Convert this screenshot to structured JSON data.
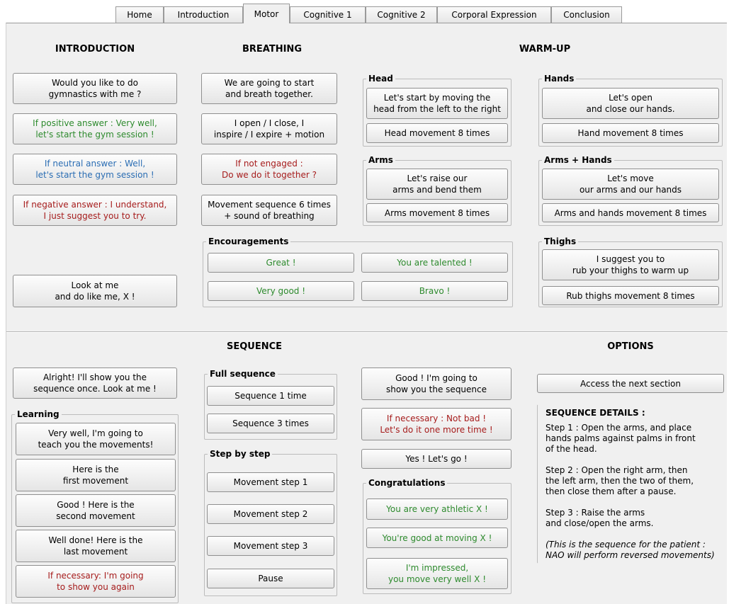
{
  "tabs": [
    {
      "label": "Home"
    },
    {
      "label": "Introduction"
    },
    {
      "label": "Motor"
    },
    {
      "label": "Cognitive 1"
    },
    {
      "label": "Cognitive 2"
    },
    {
      "label": "Corporal Expression"
    },
    {
      "label": "Conclusion"
    }
  ],
  "active_tab": "Motor",
  "headings": {
    "introduction": "INTRODUCTION",
    "breathing": "BREATHING",
    "warmup": "WARM-UP",
    "sequence": "SEQUENCE",
    "options": "OPTIONS"
  },
  "introduction": {
    "gym_question": "Would you like to do\ngymnastics with me ?",
    "positive": "If positive answer : Very well,\nlet's start the gym session !",
    "neutral": "If neutral answer : Well,\nlet's start the gym session !",
    "negative": "If negative answer : I understand,\nI just suggest you to try.",
    "look_at_me": "Look at me\nand do like me, X !"
  },
  "breathing": {
    "start_together": "We are going to start\nand breath together.",
    "open_close": "I open / I close, I\ninspire / I expire + motion",
    "not_engaged": "If not engaged :\nDo we do it together ?",
    "movement_sequence": "Movement sequence 6 times\n+ sound of breathing"
  },
  "encouragements": {
    "title": "Encouragements",
    "great": "Great !",
    "talented": "You are talented !",
    "very_good": "Very good !",
    "bravo": "Bravo !"
  },
  "warmup": {
    "head": {
      "title": "Head",
      "instruction": "Let's start by moving the\nhead from the left to the right",
      "repeat": "Head movement 8 times"
    },
    "arms": {
      "title": "Arms",
      "instruction": "Let's raise our\narms and bend them",
      "repeat": "Arms movement 8 times"
    },
    "hands": {
      "title": "Hands",
      "instruction": "Let's open\nand close our hands.",
      "repeat": "Hand movement 8 times"
    },
    "arms_hands": {
      "title": "Arms + Hands",
      "instruction": "Let's move\nour arms and our hands",
      "repeat": "Arms and hands movement 8 times"
    },
    "thighs": {
      "title": "Thighs",
      "instruction": "I suggest you to\nrub your thighs to warm up",
      "repeat": "Rub thighs movement 8 times"
    }
  },
  "sequence": {
    "show_once": "Alright! I'll show you the\nsequence once. Look at me !",
    "learning": {
      "title": "Learning",
      "teach": "Very well, I'm going to\nteach you the movements!",
      "first": "Here is the\nfirst movement",
      "second": "Good ! Here is the\nsecond movement",
      "last": "Well done! Here is the\nlast movement",
      "again": "If necessary: I'm going\nto show you again"
    },
    "full": {
      "title": "Full sequence",
      "once": "Sequence 1 time",
      "thrice": "Sequence 3 times"
    },
    "step": {
      "title": "Step by step",
      "step1": "Movement step 1",
      "step2": "Movement step 2",
      "step3": "Movement step 3",
      "pause": "Pause"
    },
    "show_sequence": "Good ! I'm going to\nshow you the sequence",
    "not_bad": "If necessary : Not bad !\nLet's do it one more time !",
    "lets_go": "Yes ! Let's go !",
    "congratulations": {
      "title": "Congratulations",
      "athletic": "You are very athletic X !",
      "good_moving": "You're good at moving X !",
      "impressed": "I'm impressed,\nyou move very well X !"
    }
  },
  "options": {
    "next_section": "Access the next section",
    "details_title": "SEQUENCE DETAILS :",
    "step1": "Step 1 : Open the arms, and place\nhands palms against palms in front\nof the head.",
    "step2": "Step 2 : Open the right arm, then\nthe left arm, then the two of them,\nthen close them after a pause.",
    "step3": "Step 3 : Raise the arms\nand close/open the arms.",
    "note": "(This is the sequence for the patient :\nNAO will perform reversed movements)"
  },
  "colors": {
    "positive": "#2d8a2d",
    "neutral": "#2a6db3",
    "negative": "#a61c1c",
    "panel_bg": "#f0f0f0"
  }
}
